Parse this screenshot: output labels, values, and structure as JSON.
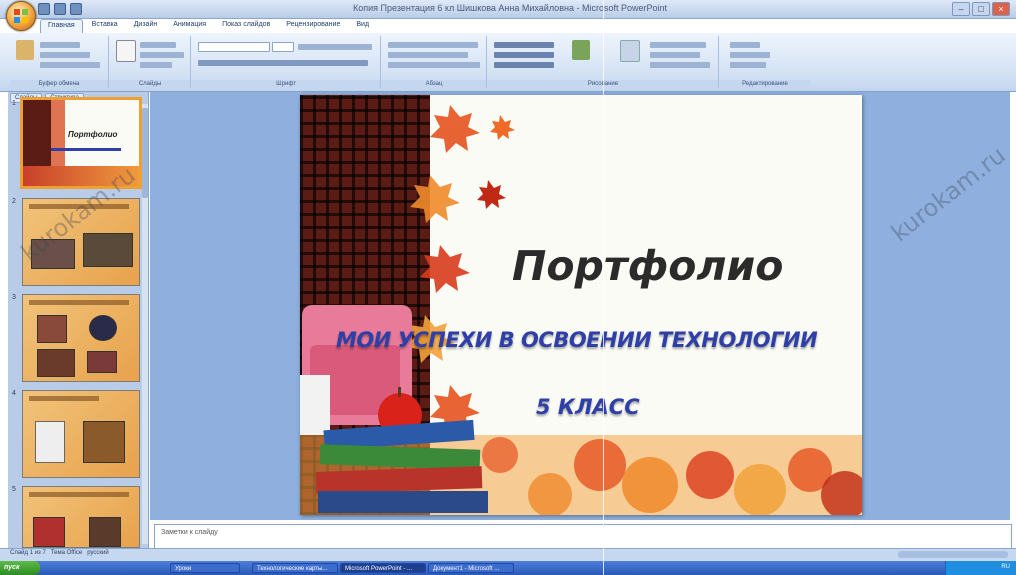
{
  "app": {
    "title": "Копия Презентация 6 кл Шишкова Анна Михайловна - Microsoft PowerPoint"
  },
  "ribbon": {
    "tabs": [
      "Главная",
      "Вставка",
      "Дизайн",
      "Анимация",
      "Показ слайдов",
      "Рецензирование",
      "Вид"
    ],
    "groups": [
      "Буфер обмена",
      "Слайды",
      "Шрифт",
      "Абзац",
      "Рисование",
      "Редактирование"
    ]
  },
  "pane": {
    "tabs": [
      "Слайды",
      "Структура"
    ],
    "thumb1_title": "Портфолио"
  },
  "slide": {
    "title": "Портфолио",
    "subtitle": "МОИ УСПЕХИ В ОСВОЕНИИ ТЕХНОЛОГИИ",
    "class": "5 КЛАСС"
  },
  "notes": {
    "placeholder": "Заметки к слайду"
  },
  "status": {
    "slide_info": "Слайд 1 из 7",
    "theme": "Тема Office",
    "lang": "русский"
  },
  "taskbar": {
    "start": "пуск",
    "items": [
      "Уроки",
      "Технологические карты...",
      "Microsoft PowerPoint - ...",
      "Документ1 - Microsoft ..."
    ],
    "clock": "RU"
  },
  "watermark": "kurokam.ru",
  "colors": {
    "accent_subtitle": "#2f3fa8",
    "workspace": "#8fb0de",
    "selection": "#f0a030"
  }
}
